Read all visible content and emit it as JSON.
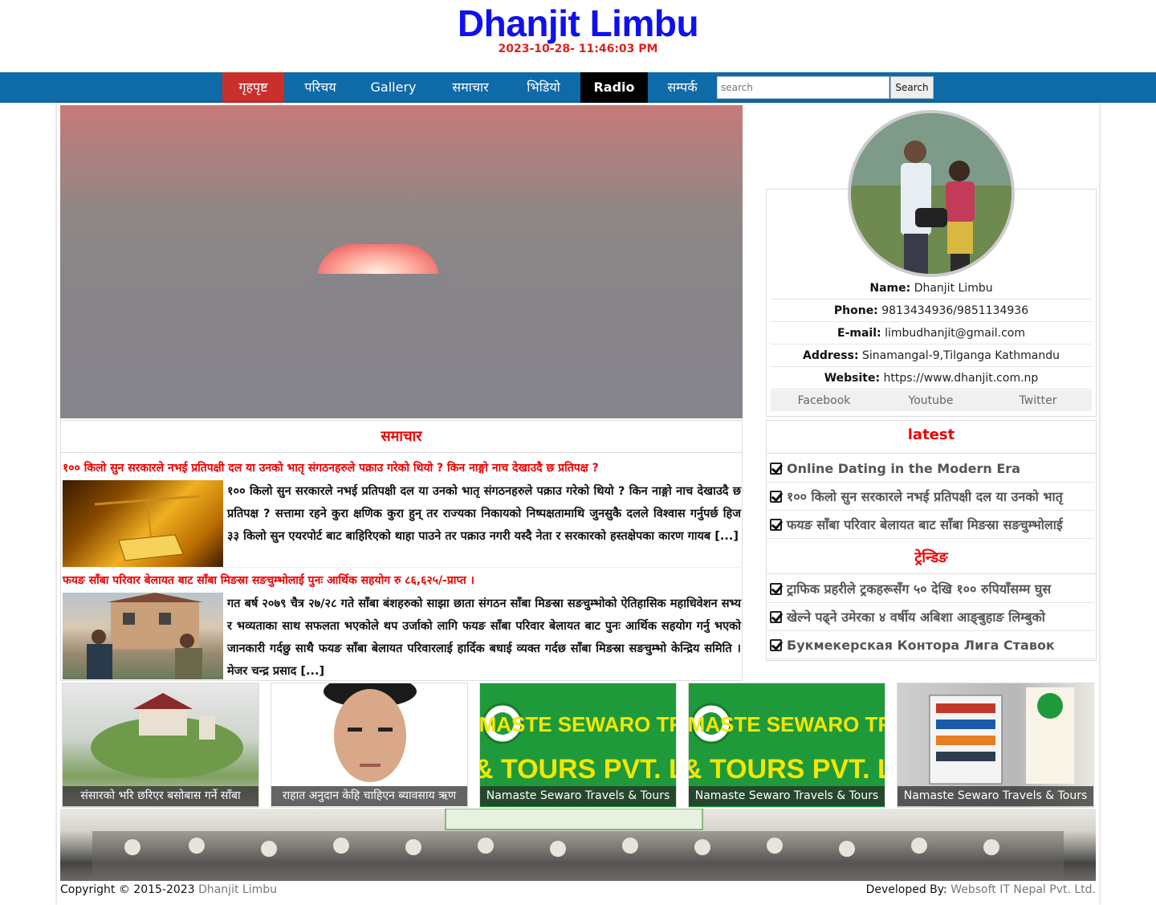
{
  "header": {
    "title": "Dhanjit Limbu",
    "datetime": "2023-10-28- 11:46:03 PM"
  },
  "nav": {
    "items": [
      {
        "label": "गृहपृष्ट",
        "active": true
      },
      {
        "label": "परिचय"
      },
      {
        "label": "Gallery"
      },
      {
        "label": "समाचार"
      },
      {
        "label": "भिडियो"
      },
      {
        "label": "Radio"
      },
      {
        "label": "सम्पर्क"
      }
    ],
    "search_placeholder": "search",
    "search_button": "Search"
  },
  "news": {
    "heading": "समाचार",
    "items": [
      {
        "title": "१०० किलो सुन सरकारले नभई प्रतिपक्षी दल या उनको भातृ संगठनहरुले पक्राउ गरेको थियो ? किन नाङ्गो नाच देखाउदै छ प्रतिपक्ष ?",
        "excerpt": "१०० किलो सुन सरकारले नभई प्रतिपक्षी दल या उनको भातृ संगठनहरुले पक्राउ गरेको थियो ? किन नाङ्गो नाच देखाउदै छ प्रतिपक्ष ? सत्तामा रहने कुरा क्षणिक कुरा हुन् तर राज्यका निकायको निष्पक्षतामाथि जुनसुकै दलले विश्वास गर्नुपर्छ हिज ३३ किलो सुन एयरपोर्ट बाट बाहिरिएको थाहा पाउने तर पक्राउ नगरी  यस्दै नेता र सरकारको हस्तक्षेपका कारण गायब [...]",
        "thumb": "gold-bar"
      },
      {
        "title": "फयङ साँबा परिवार बेलायत बाट साँबा मिङस्रा सङचुम्भोलाई पुनः आर्थिक सहयोग रु ८६,६२५/-प्राप्त ।",
        "excerpt": "गत बर्ष २०७९ चैत्र २७/२८ गते साँबा बंशहरुको साझा छाता संगठन साँबा मिङस्रा सङचुम्भोको ऐतिहासिक महाधिवेशन सभ्य र भव्यताका साथ सफलता भएकोले थप उर्जाको लागि फयङ साँबा परिवार बेलायत बाट पुनः आर्थिक सहयोग गर्नु भएको जानकारी गर्दछु साथै फयङ साँबा बेलायत परिवारलाई हार्दिक बधाई व्यक्त गर्दछ साँबा मिङस्रा सङचुम्भो केन्द्रिय समिति । मेजर चन्द्र प्रसाद [...]",
        "thumb": "house-people"
      }
    ]
  },
  "profile": {
    "rows": [
      {
        "label": "Name:",
        "value": "Dhanjit Limbu"
      },
      {
        "label": "Phone:",
        "value": "9813434936/9851134936"
      },
      {
        "label": "E-mail:",
        "value": "limbudhanjit@gmail.com"
      },
      {
        "label": "Address:",
        "value": "Sinamangal-9,Tilganga Kathmandu"
      },
      {
        "label": "Website:",
        "value": "https://www.dhanjit.com.np"
      }
    ],
    "social": [
      "Facebook",
      "Youtube",
      "Twitter"
    ]
  },
  "latest": {
    "heading": "latest",
    "items": [
      "Online Dating in the Modern Era",
      "१०० किलो सुन सरकारले नभई प्रतिपक्षी दल या उनको भातृ",
      "फयङ साँबा परिवार बेलायत बाट साँबा मिङस्रा सङचुम्भोलाई"
    ]
  },
  "trending": {
    "heading": "ट्रेन्डिङ",
    "items": [
      "ट्राफिक प्रहरीले ट्रकहरूसँग ५० देखि १०० रुपियाँसम्म घुस",
      "खेल्ने पढ्ने उमेरका ४ वर्षीय अबिशा आङ्बुहाङ लिम्बुको",
      "Букмекерская Контора Лига Ставок"
    ]
  },
  "cards": [
    {
      "caption": "संसारको भरि छरिएर बसोबास गर्ने साँबा",
      "image": "model-house"
    },
    {
      "caption": "राहात अनुदान केहि चाहिएन ब्यावसाय ऋण",
      "image": "portrait"
    },
    {
      "caption": "Namaste Sewaro Travels & Tours",
      "image": "travel-logo"
    },
    {
      "caption": "Namaste Sewaro Travels & Tours",
      "image": "travel-logo"
    },
    {
      "caption": "Namaste Sewaro Travels & Tours",
      "image": "travel-office"
    }
  ],
  "travel_banner": {
    "line1": "NAMASTE SEWARO TRAVELS",
    "line2": "& TOURS PVT. LTD."
  },
  "footer": {
    "copyright": "Copyright © 2015-2023",
    "copyright_name": "Dhanjit Limbu",
    "developer_label": "Developed By:",
    "developer": "Websoft IT Nepal Pvt. Ltd."
  },
  "colors": {
    "title_blue": "#1010ee",
    "accent_red": "#e00000",
    "nav_blue": "#0f6aa8",
    "nav_active": "#c9302c"
  }
}
